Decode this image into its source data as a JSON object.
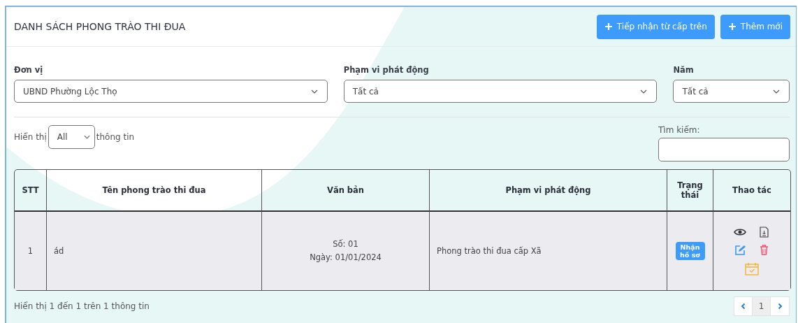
{
  "title": "DANH SÁCH PHONG TRÀO THI ĐUA",
  "header_buttons": [
    {
      "label": "Tiếp nhận từ cấp trên"
    },
    {
      "label": "Thêm mới"
    }
  ],
  "filters": [
    {
      "label": "Đơn vị",
      "value": "UBND Phường Lộc Thọ"
    },
    {
      "label": "Phạm vi phát động",
      "value": "Tất cả"
    },
    {
      "label": "Năm",
      "value": "Tất cả"
    }
  ],
  "length": {
    "prefix": "Hiển thị",
    "value": "All",
    "suffix": "thông tin"
  },
  "search": {
    "label": "Tìm kiếm:"
  },
  "table": {
    "columns": [
      "STT",
      "Tên phong trào thi đua",
      "Văn bản",
      "Phạm vi phát động",
      "Trạng thái",
      "Thao tác"
    ],
    "rows": [
      {
        "stt": "1",
        "name": "ád",
        "document": [
          "Số: 01",
          "Ngày: 01/01/2024"
        ],
        "scope": "Phong trào thi đua cấp Xã",
        "status": "Nhận hồ sơ",
        "actions": [
          {
            "kind": "view"
          },
          {
            "kind": "download"
          },
          {
            "kind": "edit"
          },
          {
            "kind": "delete"
          },
          {
            "kind": "schedule"
          }
        ]
      }
    ]
  },
  "info": "Hiển thị 1 đến 1 trên 1 thông tin",
  "pagination": [
    {
      "kind": "prev"
    },
    {
      "kind": "page",
      "label": "1",
      "selected": true
    },
    {
      "kind": "next"
    }
  ]
}
